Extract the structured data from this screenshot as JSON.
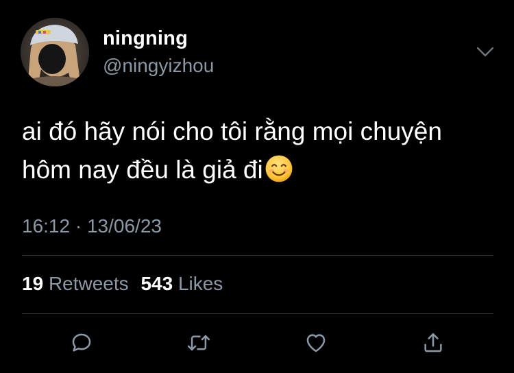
{
  "author": {
    "display_name": "ningning",
    "handle": "@ningyizhou",
    "avatar_icon": "profile-photo"
  },
  "tweet": {
    "text_line1": "ai đó hãy nói cho tôi rằng mọi chuyện",
    "text_line2": "hôm nay đều là giả đi",
    "emoji": "smiling-face-with-smiling-eyes",
    "time": "16:12",
    "separator": "·",
    "date": "13/06/23"
  },
  "stats": {
    "retweets_count": "19",
    "retweets_label": "Retweets",
    "likes_count": "543",
    "likes_label": "Likes"
  },
  "actions": {
    "reply_icon": "reply-icon",
    "retweet_icon": "retweet-icon",
    "like_icon": "heart-icon",
    "share_icon": "share-icon"
  },
  "colors": {
    "background": "#000000",
    "primary_text": "#ffffff",
    "secondary_text": "#8b98a5",
    "divider": "#2f3336"
  }
}
